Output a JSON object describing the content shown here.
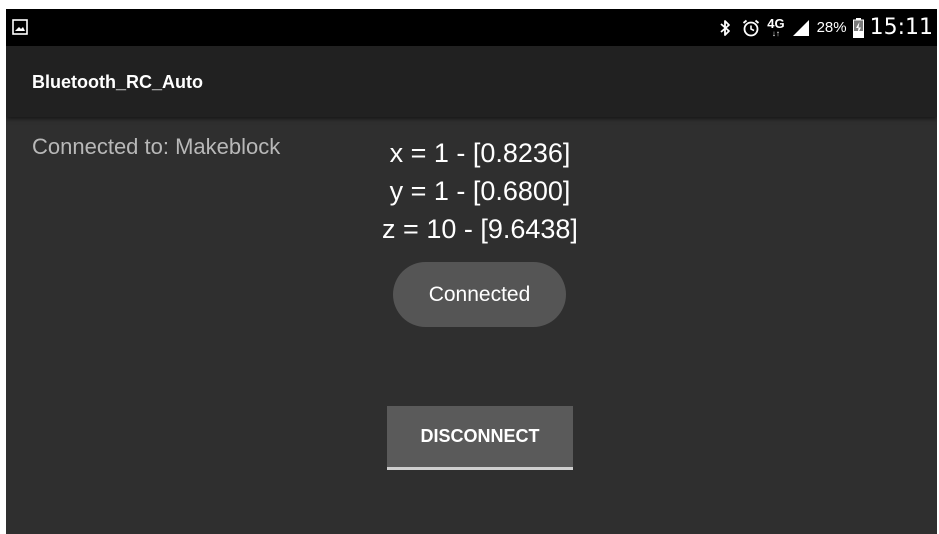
{
  "status_bar": {
    "left_icon": "gallery-notification-icon",
    "bluetooth_icon": "bluetooth-icon",
    "alarm_icon": "alarm-icon",
    "network_type": "4G",
    "network_arrows": "↓↑",
    "signal_icon": "signal-strength-icon",
    "battery_percent": "28%",
    "battery_icon": "battery-charging-icon",
    "time": "15:11"
  },
  "action_bar": {
    "title": "Bluetooth_RC_Auto"
  },
  "main": {
    "connected_to": "Connected to: Makeblock",
    "readouts": {
      "x": "x = 1 - [0.8236]",
      "y": "y = 1 - [0.6800]",
      "z": "z = 10 - [9.6438]"
    },
    "status_pill": "Connected",
    "disconnect_label": "DISCONNECT"
  },
  "colors": {
    "background": "#2f2f2f",
    "action_bar": "#212121",
    "status_bar": "#000000",
    "button": "#5a5a5a",
    "pill": "#555555",
    "secondary_text": "#b8b8b8"
  }
}
